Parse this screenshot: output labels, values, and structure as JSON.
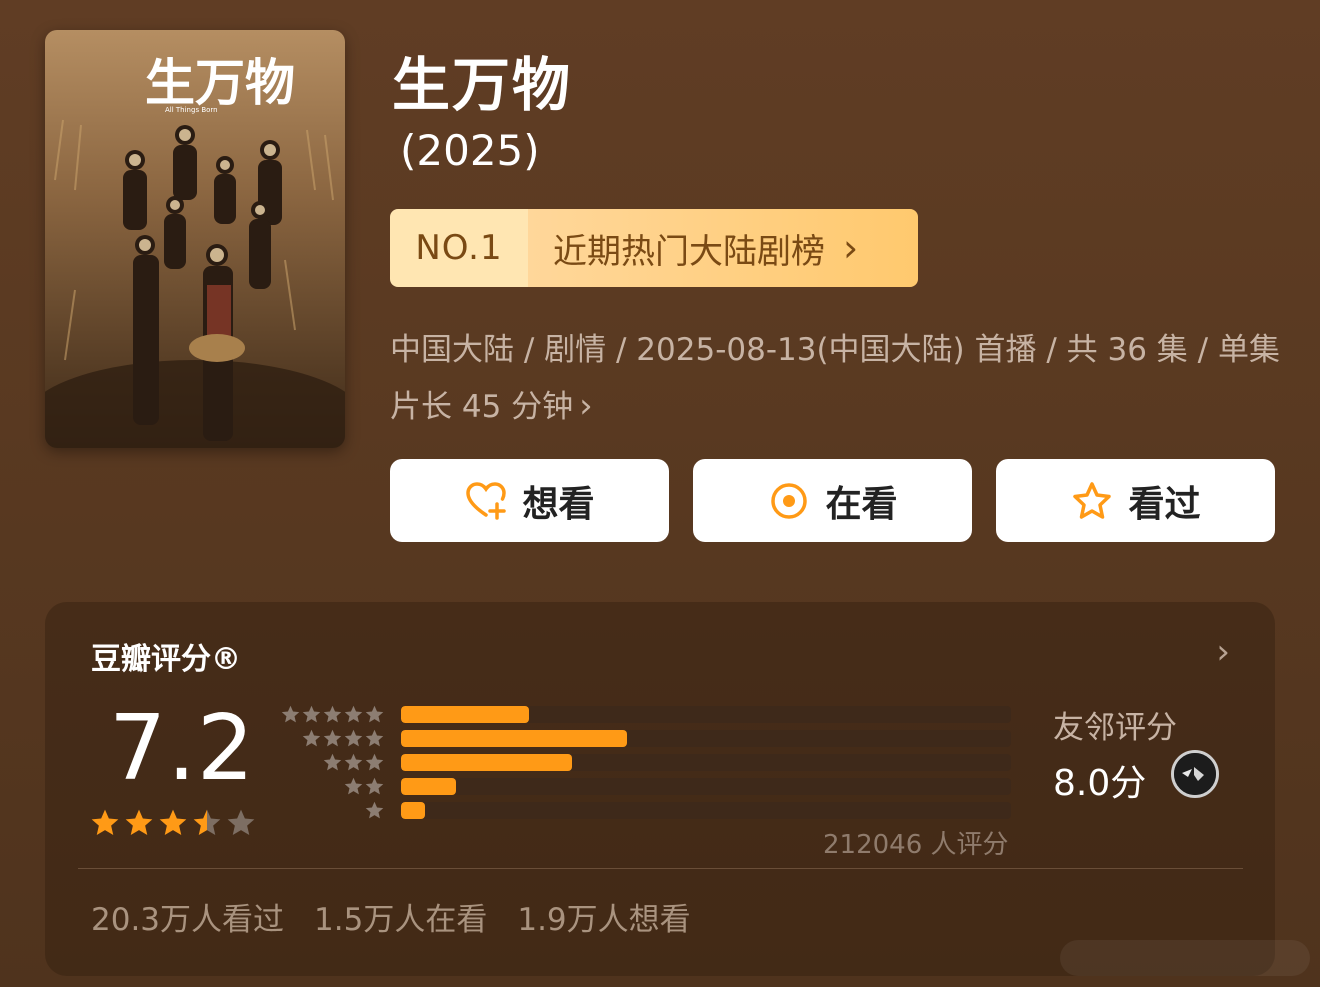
{
  "title": "生万物",
  "year": "(2025)",
  "poster": {
    "title_art": "生万物",
    "subtitle_art": "All Things Born"
  },
  "rank": {
    "no": "NO.1",
    "label": "近期热门大陆剧榜"
  },
  "meta": {
    "line": "中国大陆 / 剧情 / 2025-08-13(中国大陆) 首播 / 共 36 集 / 单集片长 45 分钟"
  },
  "actions": {
    "want": "想看",
    "doing": "在看",
    "done": "看过"
  },
  "rating": {
    "title": "豆瓣评分®",
    "score": "7.2",
    "score_stars": 3.5,
    "distribution_percent": [
      21,
      37,
      28,
      9,
      4
    ],
    "count_text": "212046 人评分",
    "friend_label": "友邻评分",
    "friend_score": "8.0分",
    "stats": [
      "20.3万人看过",
      "1.5万人在看",
      "1.9万人想看"
    ]
  },
  "colors": {
    "accent": "#ff9a16",
    "background": "#5a3a22",
    "rank_text": "#7a4a14"
  },
  "icons": {
    "want": "heart-plus-icon",
    "doing": "target-circle-icon",
    "done": "star-outline-icon"
  }
}
